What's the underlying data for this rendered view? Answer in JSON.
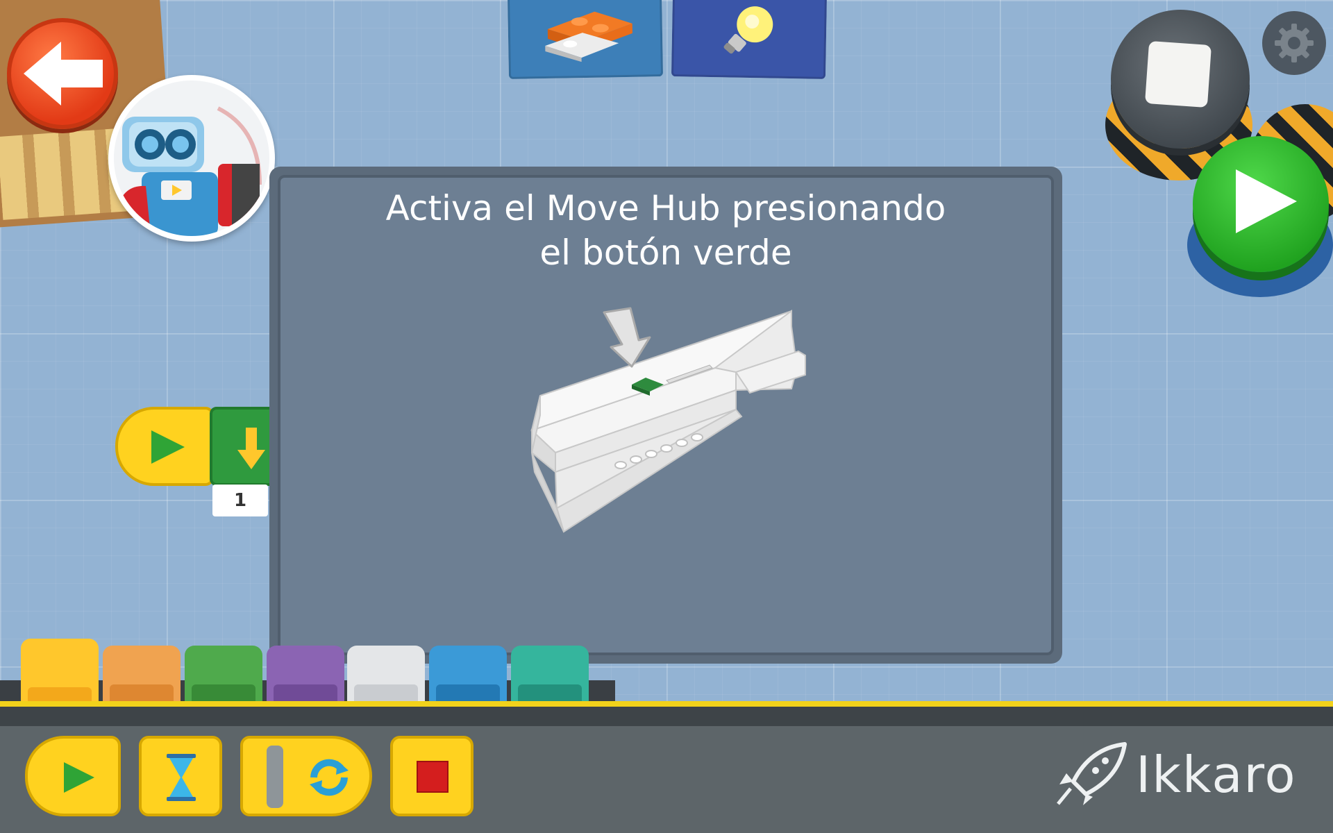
{
  "top_tabs": [
    {
      "name": "bricks-tab",
      "icon": "lego-bricks-icon",
      "color": "#3d7fb8"
    },
    {
      "name": "idea-tab",
      "icon": "lightbulb-icon",
      "color": "#3a55a8"
    }
  ],
  "navigation": {
    "back_icon": "back-arrow-icon",
    "back_color": "#e23a16"
  },
  "controls": {
    "settings_icon": "gear-icon",
    "stop_icon": "stop-square-icon",
    "play_icon": "play-triangle-icon",
    "play_color": "#20a21f"
  },
  "program": {
    "blocks": [
      {
        "type": "start",
        "icon": "play-icon",
        "color": "#ffd21f"
      },
      {
        "type": "move",
        "icon": "down-arrow-icon",
        "color": "#2f9a3e",
        "parameter": "1"
      }
    ]
  },
  "modal": {
    "message_line1": "Activa el Move Hub presionando",
    "message_line2": "el botón verde",
    "illustration": "move-hub-with-arrow-illustration",
    "button_color": "#2e8b3e"
  },
  "palette_tabs": [
    {
      "color": "#ffc72c",
      "selected": true
    },
    {
      "color": "#f0a350"
    },
    {
      "color": "#4faa4c"
    },
    {
      "color": "#8b64b3"
    },
    {
      "color": "#e4e6e8"
    },
    {
      "color": "#3b9ad7"
    },
    {
      "color": "#35b59d"
    }
  ],
  "toolbox": [
    {
      "name": "start-block",
      "icon": "play-icon"
    },
    {
      "name": "wait-block",
      "icon": "hourglass-icon"
    },
    {
      "name": "loop-block",
      "icon": "loop-icon"
    },
    {
      "name": "stop-block",
      "icon": "stop-icon"
    }
  ],
  "brand": {
    "name": "Ikkaro",
    "icon": "rocket-icon"
  }
}
